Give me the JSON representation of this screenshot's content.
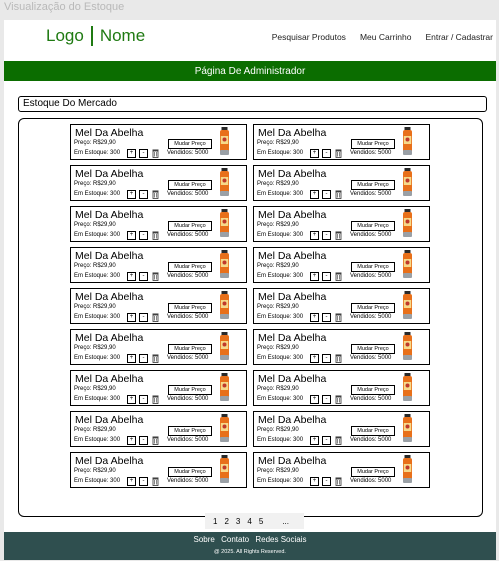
{
  "frame_title": "Visualização do Estoque",
  "header": {
    "logo_left": "Logo",
    "logo_right": "Nome",
    "nav": [
      "Pesquisar Produtos",
      "Meu Carrinho",
      "Entrar / Cadastrar"
    ]
  },
  "admin_bar": "Página De Administrador",
  "section_title": "Estoque Do Mercado",
  "products": [
    {
      "name": "Mel Da Abelha",
      "price": "Preço: R$29,90",
      "stock": "Em Estoque: 300",
      "sold": "Vendidos: 5000",
      "change_price": "Mudar Preço",
      "plus": "+",
      "minus": "-"
    },
    {
      "name": "Mel Da Abelha",
      "price": "Preço: R$29,90",
      "stock": "Em Estoque: 300",
      "sold": "Vendidos: 5000",
      "change_price": "Mudar Preço",
      "plus": "+",
      "minus": "-"
    },
    {
      "name": "Mel Da Abelha",
      "price": "Preço: R$29,90",
      "stock": "Em Estoque: 300",
      "sold": "Vendidos: 5000",
      "change_price": "Mudar Preço",
      "plus": "+",
      "minus": "-"
    },
    {
      "name": "Mel Da Abelha",
      "price": "Preço: R$29,90",
      "stock": "Em Estoque: 300",
      "sold": "Vendidos: 5000",
      "change_price": "Mudar Preço",
      "plus": "+",
      "minus": "-"
    },
    {
      "name": "Mel Da Abelha",
      "price": "Preço: R$29,90",
      "stock": "Em Estoque: 300",
      "sold": "Vendidos: 5000",
      "change_price": "Mudar Preço",
      "plus": "+",
      "minus": "-"
    },
    {
      "name": "Mel Da Abelha",
      "price": "Preço: R$29,90",
      "stock": "Em Estoque: 300",
      "sold": "Vendidos: 5000",
      "change_price": "Mudar Preço",
      "plus": "+",
      "minus": "-"
    },
    {
      "name": "Mel Da Abelha",
      "price": "Preço: R$29,90",
      "stock": "Em Estoque: 300",
      "sold": "Vendidos: 5000",
      "change_price": "Mudar Preço",
      "plus": "+",
      "minus": "-"
    },
    {
      "name": "Mel Da Abelha",
      "price": "Preço: R$29,90",
      "stock": "Em Estoque: 300",
      "sold": "Vendidos: 5000",
      "change_price": "Mudar Preço",
      "plus": "+",
      "minus": "-"
    },
    {
      "name": "Mel Da Abelha",
      "price": "Preço: R$29,90",
      "stock": "Em Estoque: 300",
      "sold": "Vendidos: 5000",
      "change_price": "Mudar Preço",
      "plus": "+",
      "minus": "-"
    },
    {
      "name": "Mel Da Abelha",
      "price": "Preço: R$29,90",
      "stock": "Em Estoque: 300",
      "sold": "Vendidos: 5000",
      "change_price": "Mudar Preço",
      "plus": "+",
      "minus": "-"
    },
    {
      "name": "Mel Da Abelha",
      "price": "Preço: R$29,90",
      "stock": "Em Estoque: 300",
      "sold": "Vendidos: 5000",
      "change_price": "Mudar Preço",
      "plus": "+",
      "minus": "-"
    },
    {
      "name": "Mel Da Abelha",
      "price": "Preço: R$29,90",
      "stock": "Em Estoque: 300",
      "sold": "Vendidos: 5000",
      "change_price": "Mudar Preço",
      "plus": "+",
      "minus": "-"
    },
    {
      "name": "Mel Da Abelha",
      "price": "Preço: R$29,90",
      "stock": "Em Estoque: 300",
      "sold": "Vendidos: 5000",
      "change_price": "Mudar Preço",
      "plus": "+",
      "minus": "-"
    },
    {
      "name": "Mel Da Abelha",
      "price": "Preço: R$29,90",
      "stock": "Em Estoque: 300",
      "sold": "Vendidos: 5000",
      "change_price": "Mudar Preço",
      "plus": "+",
      "minus": "-"
    },
    {
      "name": "Mel Da Abelha",
      "price": "Preço: R$29,90",
      "stock": "Em Estoque: 300",
      "sold": "Vendidos: 5000",
      "change_price": "Mudar Preço",
      "plus": "+",
      "minus": "-"
    },
    {
      "name": "Mel Da Abelha",
      "price": "Preço: R$29,90",
      "stock": "Em Estoque: 300",
      "sold": "Vendidos: 5000",
      "change_price": "Mudar Preço",
      "plus": "+",
      "minus": "-"
    },
    {
      "name": "Mel Da Abelha",
      "price": "Preço: R$29,90",
      "stock": "Em Estoque: 300",
      "sold": "Vendidos: 5000",
      "change_price": "Mudar Preço",
      "plus": "+",
      "minus": "-"
    },
    {
      "name": "Mel Da Abelha",
      "price": "Preço: R$29,90",
      "stock": "Em Estoque: 300",
      "sold": "Vendidos: 5000",
      "change_price": "Mudar Preço",
      "plus": "+",
      "minus": "-"
    }
  ],
  "pagination": [
    "1",
    "2",
    "3",
    "4",
    "5",
    "..."
  ],
  "footer": {
    "links": [
      "Sobre",
      "Contato",
      "Redes Sociais"
    ],
    "copyright": "@ 2025. All Rights Reserved."
  },
  "colors": {
    "brand": "#1f7a12",
    "admin_bar": "#0b6d00",
    "footer": "#2f4f4f"
  },
  "icons": {
    "trash": "trash-icon",
    "product": "honey-jar-icon"
  }
}
